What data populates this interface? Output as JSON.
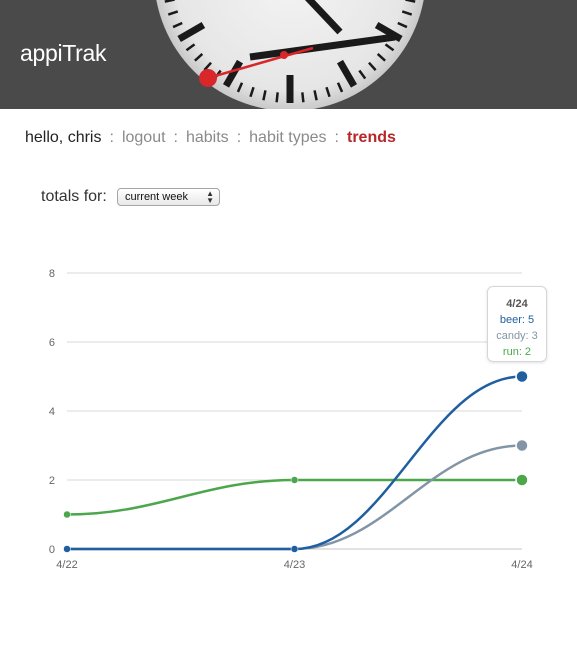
{
  "app": {
    "title": "appiTrak"
  },
  "nav": {
    "greeting": "hello, chris",
    "separator": ":",
    "items": [
      {
        "label": "logout"
      },
      {
        "label": "habits"
      },
      {
        "label": "habit types"
      },
      {
        "label": "trends",
        "active": true
      }
    ]
  },
  "filter": {
    "label": "totals for:",
    "selected": "current week"
  },
  "colors": {
    "accent": "#b7262b",
    "beer": "#1f5fa0",
    "candy": "#8295a6",
    "run": "#4ca74c",
    "header": "#4a4a4a"
  },
  "tooltip": {
    "title": "4/24",
    "lines": [
      {
        "text": "beer: 5",
        "color": "#1f5fa0"
      },
      {
        "text": "candy: 3",
        "color": "#8295a6"
      },
      {
        "text": "run: 2",
        "color": "#4ca74c"
      }
    ]
  },
  "chart_data": {
    "type": "line",
    "categories": [
      "4/22",
      "4/23",
      "4/24"
    ],
    "series": [
      {
        "name": "run",
        "values": [
          1,
          2,
          2
        ],
        "color": "#4ca74c"
      },
      {
        "name": "candy",
        "values": [
          0,
          0,
          3
        ],
        "color": "#8295a6"
      },
      {
        "name": "beer",
        "values": [
          0,
          0,
          5
        ],
        "color": "#1f5fa0"
      }
    ],
    "yticks": [
      0,
      2,
      4,
      6,
      8
    ],
    "ylim": [
      0,
      8
    ],
    "grid": true,
    "legend": "none"
  }
}
